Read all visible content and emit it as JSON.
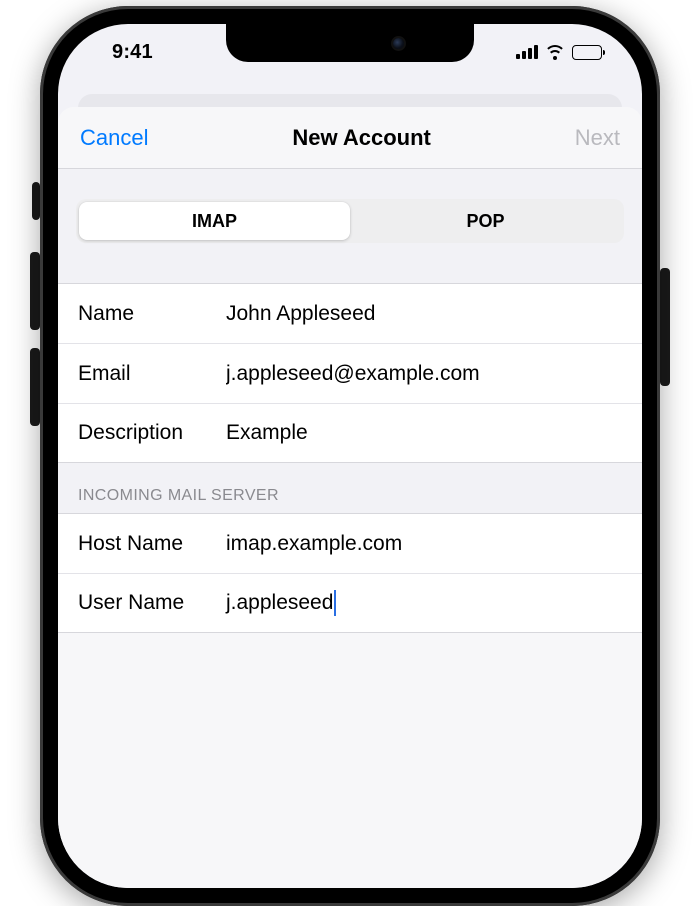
{
  "status": {
    "time": "9:41"
  },
  "nav": {
    "cancel": "Cancel",
    "title": "New Account",
    "next": "Next"
  },
  "segmented": {
    "imap": "IMAP",
    "pop": "POP"
  },
  "account": {
    "name_label": "Name",
    "name_value": "John Appleseed",
    "email_label": "Email",
    "email_value": "j.appleseed@example.com",
    "description_label": "Description",
    "description_value": "Example"
  },
  "incoming": {
    "header": "INCOMING MAIL SERVER",
    "host_label": "Host Name",
    "host_value": "imap.example.com",
    "user_label": "User Name",
    "user_value": "j.appleseed"
  }
}
